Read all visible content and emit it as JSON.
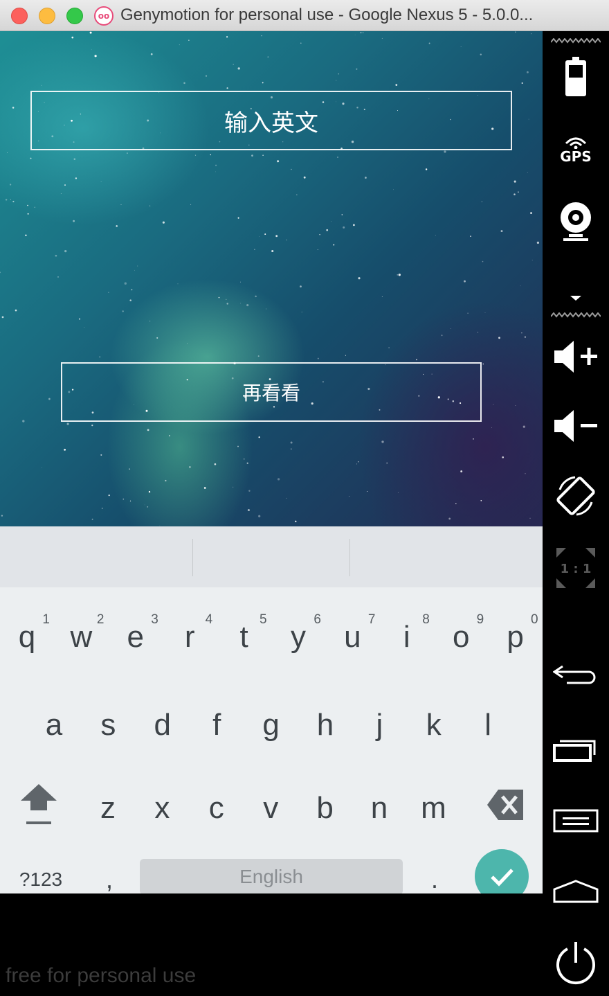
{
  "window": {
    "title": "Genymotion for personal use - Google Nexus 5 - 5.0.0...",
    "logo_text": "oo"
  },
  "app": {
    "input_placeholder": "输入英文",
    "again_button_label": "再看看"
  },
  "keyboard": {
    "row1": [
      {
        "char": "q",
        "hint": "1"
      },
      {
        "char": "w",
        "hint": "2"
      },
      {
        "char": "e",
        "hint": "3"
      },
      {
        "char": "r",
        "hint": "4"
      },
      {
        "char": "t",
        "hint": "5"
      },
      {
        "char": "y",
        "hint": "6"
      },
      {
        "char": "u",
        "hint": "7"
      },
      {
        "char": "i",
        "hint": "8"
      },
      {
        "char": "o",
        "hint": "9"
      },
      {
        "char": "p",
        "hint": "0"
      }
    ],
    "row2": [
      "a",
      "s",
      "d",
      "f",
      "g",
      "h",
      "j",
      "k",
      "l"
    ],
    "row3": [
      "z",
      "x",
      "c",
      "v",
      "b",
      "n",
      "m"
    ],
    "symbols_label": "?123",
    "comma_label": ",",
    "space_label": "English",
    "period_label": ".",
    "accent_color": "#4db6ac"
  },
  "sidebar": {
    "gps_label": "GPS",
    "ratio_label": "1 : 1",
    "icons": [
      "battery-icon",
      "gps-icon",
      "webcam-icon",
      "volume-up-icon",
      "volume-down-icon",
      "rotate-icon",
      "scale-icon",
      "back-icon",
      "recent-apps-icon",
      "menu-icon",
      "home-icon",
      "power-icon"
    ]
  },
  "watermark": "free for personal use"
}
